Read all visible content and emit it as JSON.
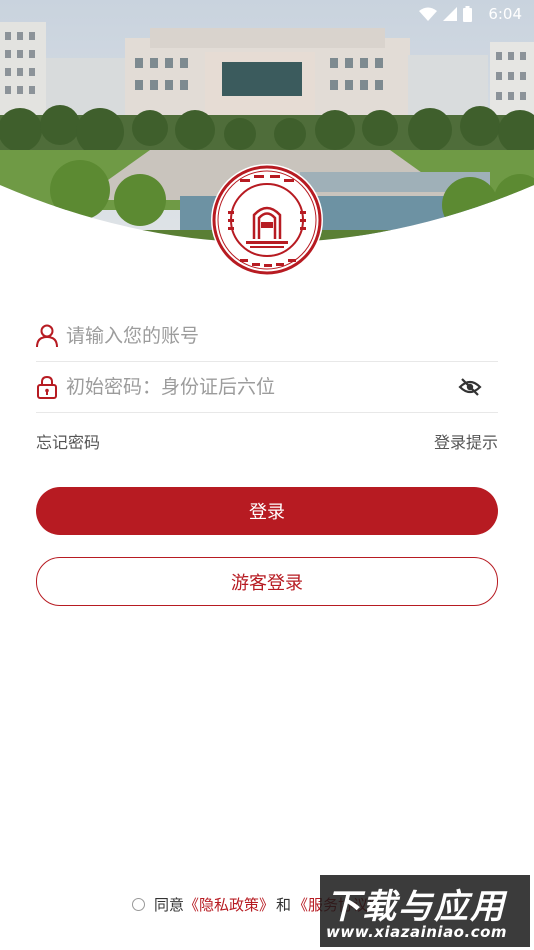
{
  "status_bar": {
    "time": "6:04"
  },
  "login": {
    "account_placeholder": "请输入您的账号",
    "password_placeholder": "初始密码：身份证后六位",
    "forgot_password": "忘记密码",
    "login_hint": "登录提示",
    "login_button": "登录",
    "guest_login_button": "游客登录"
  },
  "agreement": {
    "prefix": "同意",
    "privacy_policy": "《隐私政策》",
    "and": "和",
    "service_agreement": "《服务协议》"
  },
  "watermark": {
    "title": "下载与应用",
    "url": "www.xiazainiao.com"
  },
  "colors": {
    "brand": "#b71b22",
    "background": "#ffffff"
  },
  "icons": [
    "user-icon",
    "lock-icon",
    "eye-off-icon",
    "wifi-icon",
    "signal-icon",
    "battery-icon"
  ]
}
